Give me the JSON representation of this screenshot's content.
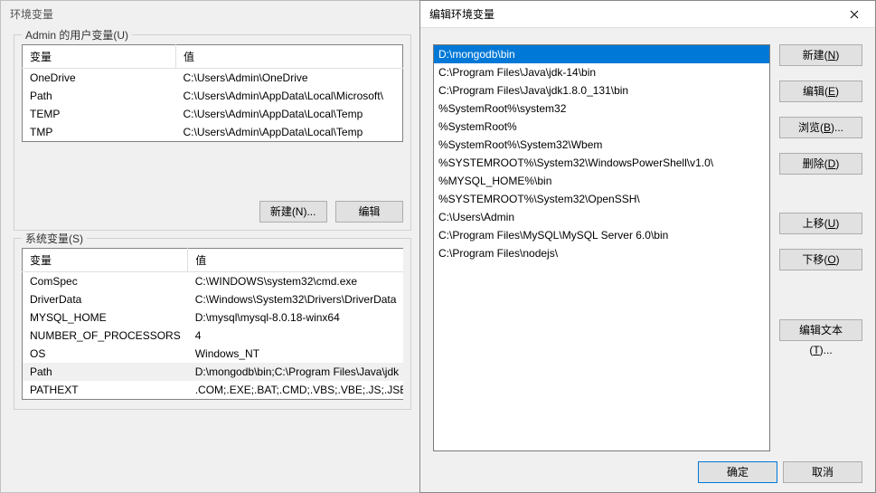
{
  "envDialog": {
    "title": "环境变量",
    "userGroup": {
      "label": "Admin 的用户变量(U)"
    },
    "sysGroup": {
      "label": "系统变量(S)"
    },
    "headers": {
      "name": "变量",
      "value": "值"
    },
    "userVars": [
      {
        "name": "OneDrive",
        "value": "C:\\Users\\Admin\\OneDrive"
      },
      {
        "name": "Path",
        "value": "C:\\Users\\Admin\\AppData\\Local\\Microsoft\\"
      },
      {
        "name": "TEMP",
        "value": "C:\\Users\\Admin\\AppData\\Local\\Temp"
      },
      {
        "name": "TMP",
        "value": "C:\\Users\\Admin\\AppData\\Local\\Temp"
      }
    ],
    "sysVars": [
      {
        "name": "ComSpec",
        "value": "C:\\WINDOWS\\system32\\cmd.exe"
      },
      {
        "name": "DriverData",
        "value": "C:\\Windows\\System32\\Drivers\\DriverData"
      },
      {
        "name": "MYSQL_HOME",
        "value": "D:\\mysql\\mysql-8.0.18-winx64"
      },
      {
        "name": "NUMBER_OF_PROCESSORS",
        "value": "4"
      },
      {
        "name": "OS",
        "value": "Windows_NT"
      },
      {
        "name": "Path",
        "value": "D:\\mongodb\\bin;C:\\Program Files\\Java\\jdk"
      },
      {
        "name": "PATHEXT",
        "value": ".COM;.EXE;.BAT;.CMD;.VBS;.VBE;.JS;.JSE;.WS"
      }
    ],
    "buttons": {
      "new": "新建(N)...",
      "edit": "编辑"
    }
  },
  "editDialog": {
    "title": "编辑环境变量",
    "paths": [
      "D:\\mongodb\\bin",
      "C:\\Program Files\\Java\\jdk-14\\bin",
      "C:\\Program Files\\Java\\jdk1.8.0_131\\bin",
      "%SystemRoot%\\system32",
      "%SystemRoot%",
      "%SystemRoot%\\System32\\Wbem",
      "%SYSTEMROOT%\\System32\\WindowsPowerShell\\v1.0\\",
      "%MYSQL_HOME%\\bin",
      "%SYSTEMROOT%\\System32\\OpenSSH\\",
      "C:\\Users\\Admin",
      "C:\\Program Files\\MySQL\\MySQL Server 6.0\\bin",
      "C:\\Program Files\\nodejs\\"
    ],
    "selectedIndex": 0,
    "buttons": {
      "new": "新建(<u>N</u>)",
      "edit": "编辑(<u>E</u>)",
      "browse": "浏览(<u>B</u>)...",
      "delete": "删除(<u>D</u>)",
      "up": "上移(<u>U</u>)",
      "down": "下移(<u>O</u>)",
      "editText": "编辑文本(<u>T</u>)...",
      "ok": "确定",
      "cancel": "取消"
    }
  }
}
